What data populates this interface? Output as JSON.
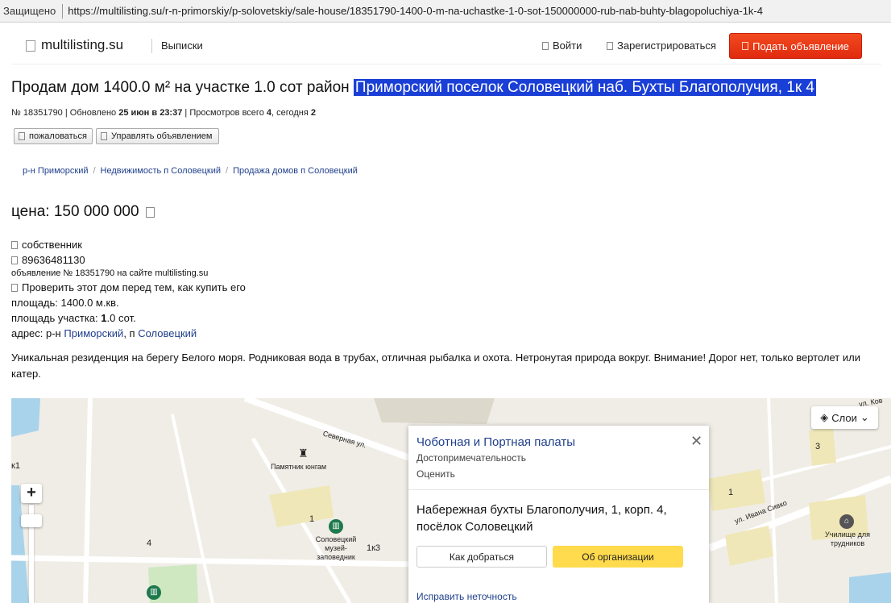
{
  "browser": {
    "secure_label": "Защищено",
    "url": "https://multilisting.su/r-n-primorskiy/p-solovetskiy/sale-house/18351790-1400-0-m-na-uchastke-1-0-sot-150000000-rub-nab-buhty-blagopoluchiya-1k-4"
  },
  "header": {
    "logo": "multilisting.su",
    "vypiski": "Выписки",
    "login": "Войти",
    "register": "Зарегистрироваться",
    "post_ad": "Подать объявление"
  },
  "listing": {
    "title_prefix": "Продам дом 1400.0 м² на участке 1.0 сот район ",
    "title_highlight": "Приморский поселок Соловецкий наб. Бухты Благополучия, 1к 4",
    "meta": {
      "number": "№ 18351790",
      "updated_label": "Обновлено",
      "updated_value": "25 июн в 23:37",
      "views_label": "Просмотров всего",
      "views_total": "4",
      "today_label": "сегодня",
      "views_today": "2"
    },
    "complain_button": "пожаловаться",
    "manage_button": "Управлять объявлением",
    "breadcrumbs": [
      "р-н Приморский",
      "Недвижимость п Соловецкий",
      "Продажа домов п Соловецкий"
    ],
    "price_label": "цена:",
    "price_value": "150 000 000",
    "owner": "собственник",
    "phone": "89636481130",
    "ad_on_site": "объявление № 18351790 на сайте multilisting.su",
    "check_house": "Проверить этот дом перед тем, как купить его",
    "area_label": "площадь:",
    "area_value": "1400.0 м.кв.",
    "plot_label": "площадь участка:",
    "plot_value_bold": "1",
    "plot_value_rest": ".0 сот.",
    "address_label": "адрес: р-н",
    "address_district": "Приморский",
    "address_sep": ", п",
    "address_settlement": "Соловецкий",
    "description": "Уникальная резиденция на берегу Белого моря. Родниковая вода в трубах, отличная рыбалка и охота. Нетронутая природа вокруг. Внимание! Дорог нет, только вертолет или катер."
  },
  "map": {
    "layers_label": "Слои",
    "zoom_in": "+",
    "labels": {
      "monument": "Памятник юнгам",
      "street_north": "Северная ул.",
      "street_sivko": "ул. Ивана Сивко",
      "street_kov": "ул. Ков",
      "museum": "Соловецкий музей-заповедник",
      "school": "Училище для трудников",
      "num_1a": "1",
      "num_1b": "1",
      "num_3": "3",
      "num_4": "4",
      "num_1k3": "1к3",
      "num_k1": "к1"
    },
    "popup": {
      "title": "Чоботная и Портная палаты",
      "category": "Достопримечательность",
      "rate": "Оценить",
      "close": "✕",
      "address": "Набережная бухты Благополучия, 1, корп. 4, посёлок Соловецкий",
      "route_button": "Как добраться",
      "org_button": "Об организации",
      "fix_link": "Исправить неточность"
    }
  }
}
